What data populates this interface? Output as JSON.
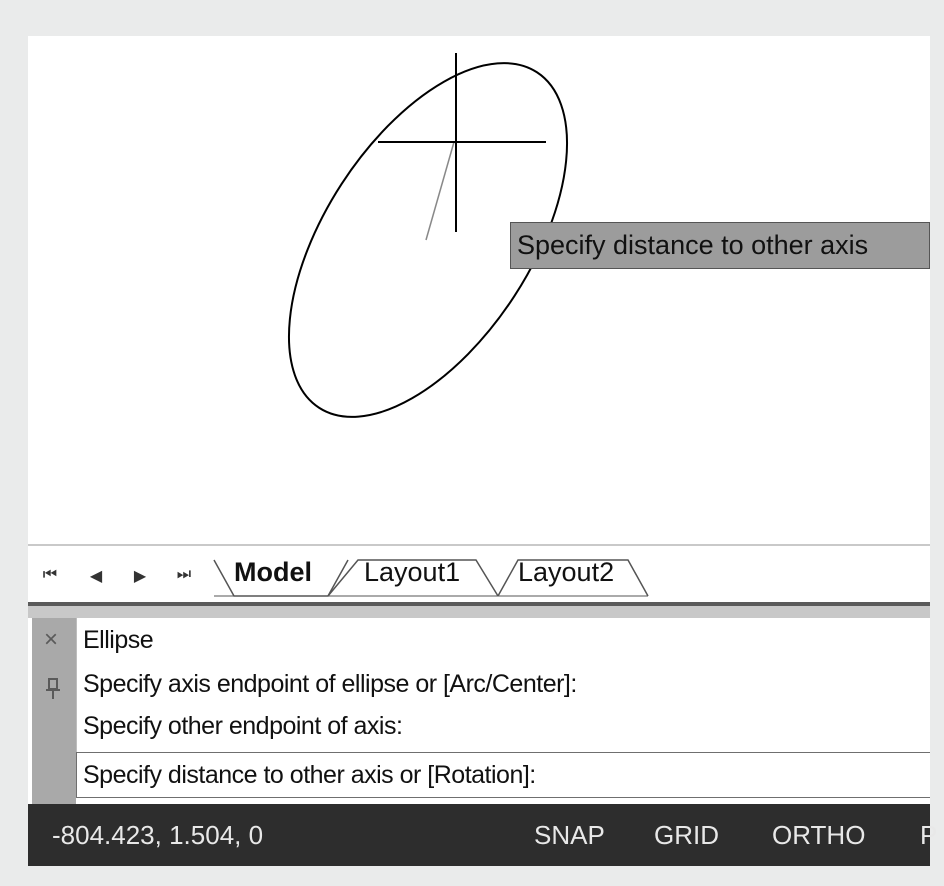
{
  "tooltip": {
    "text": "Specify distance to other axis"
  },
  "layout_tabs": {
    "nav": {
      "first": "⏮",
      "prev": "◀",
      "next": "▶",
      "last": "⏭"
    },
    "tabs": [
      {
        "label": "Model",
        "active": true
      },
      {
        "label": "Layout1",
        "active": false
      },
      {
        "label": "Layout2",
        "active": false
      }
    ]
  },
  "command_window": {
    "close_icon": "×",
    "history": [
      "Ellipse",
      "Specify axis endpoint of ellipse or [Arc/Center]:",
      "Specify other endpoint of axis:"
    ],
    "prompt": "Specify distance to other axis or [Rotation]:"
  },
  "status_bar": {
    "coordinates": "-804.423, 1.504, 0",
    "toggles": [
      "SNAP",
      "GRID",
      "ORTHO",
      "P"
    ]
  },
  "colors": {
    "canvas": "#ffffff",
    "tooltip_bg": "#9c9c9c",
    "status_bg": "#2d2d2d"
  }
}
